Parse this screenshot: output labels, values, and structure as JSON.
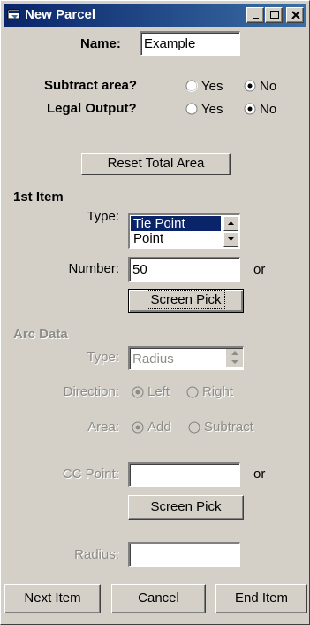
{
  "window": {
    "title": "New Parcel",
    "icon": "parcel-app-icon"
  },
  "titlebar_buttons": {
    "minimize": "minimize-icon",
    "maximize": "maximize-icon",
    "close": "close-icon"
  },
  "name": {
    "label": "Name:",
    "value": "Example"
  },
  "subtract_area": {
    "label": "Subtract area?",
    "yes": "Yes",
    "no": "No",
    "selected": "No"
  },
  "legal_output": {
    "label": "Legal Output?",
    "yes": "Yes",
    "no": "No",
    "selected": "No"
  },
  "reset_button": "Reset Total Area",
  "first_item": {
    "heading": "1st Item",
    "type_label": "Type:",
    "type_options": [
      "Tie Point",
      "Point"
    ],
    "selected_type": "Tie Point",
    "number_label": "Number:",
    "number_value": "50",
    "or_text": "or",
    "screen_pick": "Screen Pick"
  },
  "arc_data": {
    "heading": "Arc Data",
    "type_label": "Type:",
    "type_value": "Radius",
    "direction_label": "Direction:",
    "direction_left": "Left",
    "direction_right": "Right",
    "direction_selected": "Left",
    "area_label": "Area:",
    "area_add": "Add",
    "area_subtract": "Subtract",
    "area_selected": "Add",
    "cc_point_label": "CC Point:",
    "cc_point_value": "",
    "or_text": "or",
    "screen_pick": "Screen Pick",
    "radius_label": "Radius:",
    "radius_value": ""
  },
  "footer": {
    "next_item": "Next Item",
    "cancel": "Cancel",
    "end_item": "End Item"
  },
  "colors": {
    "face": "#d4d0c8",
    "title_start": "#0a246a",
    "title_end": "#3a6ea5",
    "selection": "#0a246a",
    "disabled_text": "#8e8c86"
  }
}
